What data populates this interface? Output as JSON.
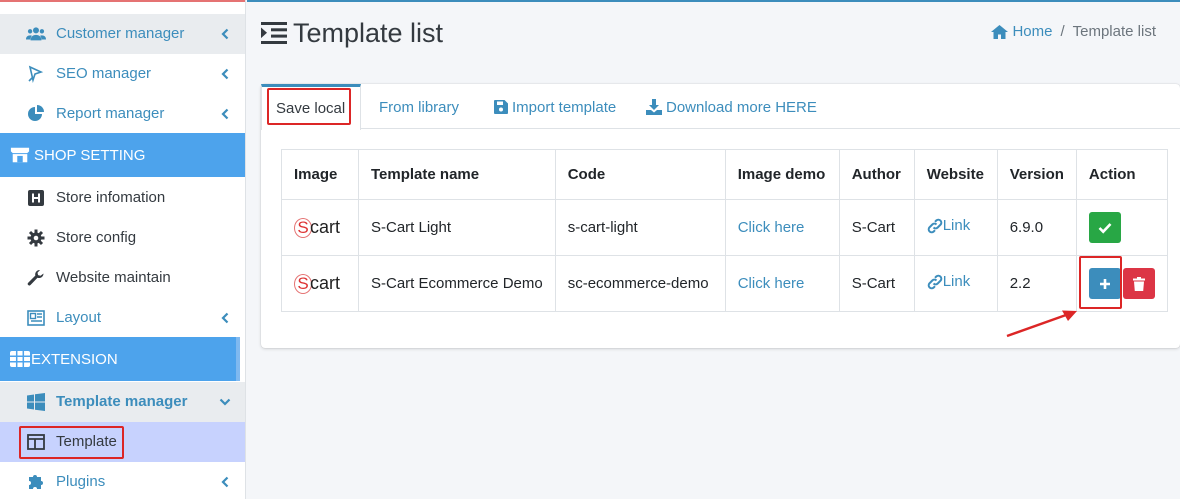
{
  "sidebar": {
    "items": [
      {
        "label": "Customer manager",
        "icon": "users-icon"
      },
      {
        "label": "SEO manager",
        "icon": "seo-icon"
      },
      {
        "label": "Report manager",
        "icon": "pie-chart-icon"
      },
      {
        "label": "Store infomation",
        "icon": "h-square-icon"
      },
      {
        "label": "Store config",
        "icon": "gear-icon"
      },
      {
        "label": "Website maintain",
        "icon": "wrench-icon"
      },
      {
        "label": "Layout",
        "icon": "layout-icon"
      },
      {
        "label": "Template manager",
        "icon": "windows-icon"
      },
      {
        "label": "Template",
        "icon": "columns-icon"
      },
      {
        "label": "Plugins",
        "icon": "puzzle-icon"
      }
    ],
    "headers": {
      "shop_setting": "SHOP SETTING",
      "extension": "EXTENSION"
    }
  },
  "header": {
    "title": "Template list",
    "breadcrumb": {
      "home": "Home",
      "separator": "/",
      "current": "Template list"
    }
  },
  "tabs": [
    {
      "label": "Save local"
    },
    {
      "label": "From library"
    },
    {
      "label": "Import template"
    },
    {
      "label": "Download more HERE"
    }
  ],
  "table": {
    "columns": [
      "Image",
      "Template name",
      "Code",
      "Image demo",
      "Author",
      "Website",
      "Version",
      "Action"
    ],
    "logo_letter": "S",
    "logo_text": "cart",
    "rows": [
      {
        "name": "S-Cart Light",
        "code": "s-cart-light",
        "demo": "Click here",
        "author": "S-Cart",
        "website": "Link",
        "version": "6.9.0"
      },
      {
        "name": "S-Cart Ecommerce Demo",
        "code": "sc-ecommerce-demo",
        "demo": "Click here",
        "author": "S-Cart",
        "website": "Link",
        "version": "2.2"
      }
    ]
  },
  "colors": {
    "accent": "#3c8dbc",
    "sidebar_header": "#4da3ec",
    "success": "#28a745",
    "danger": "#dc3545",
    "annotation": "#dc2626"
  }
}
